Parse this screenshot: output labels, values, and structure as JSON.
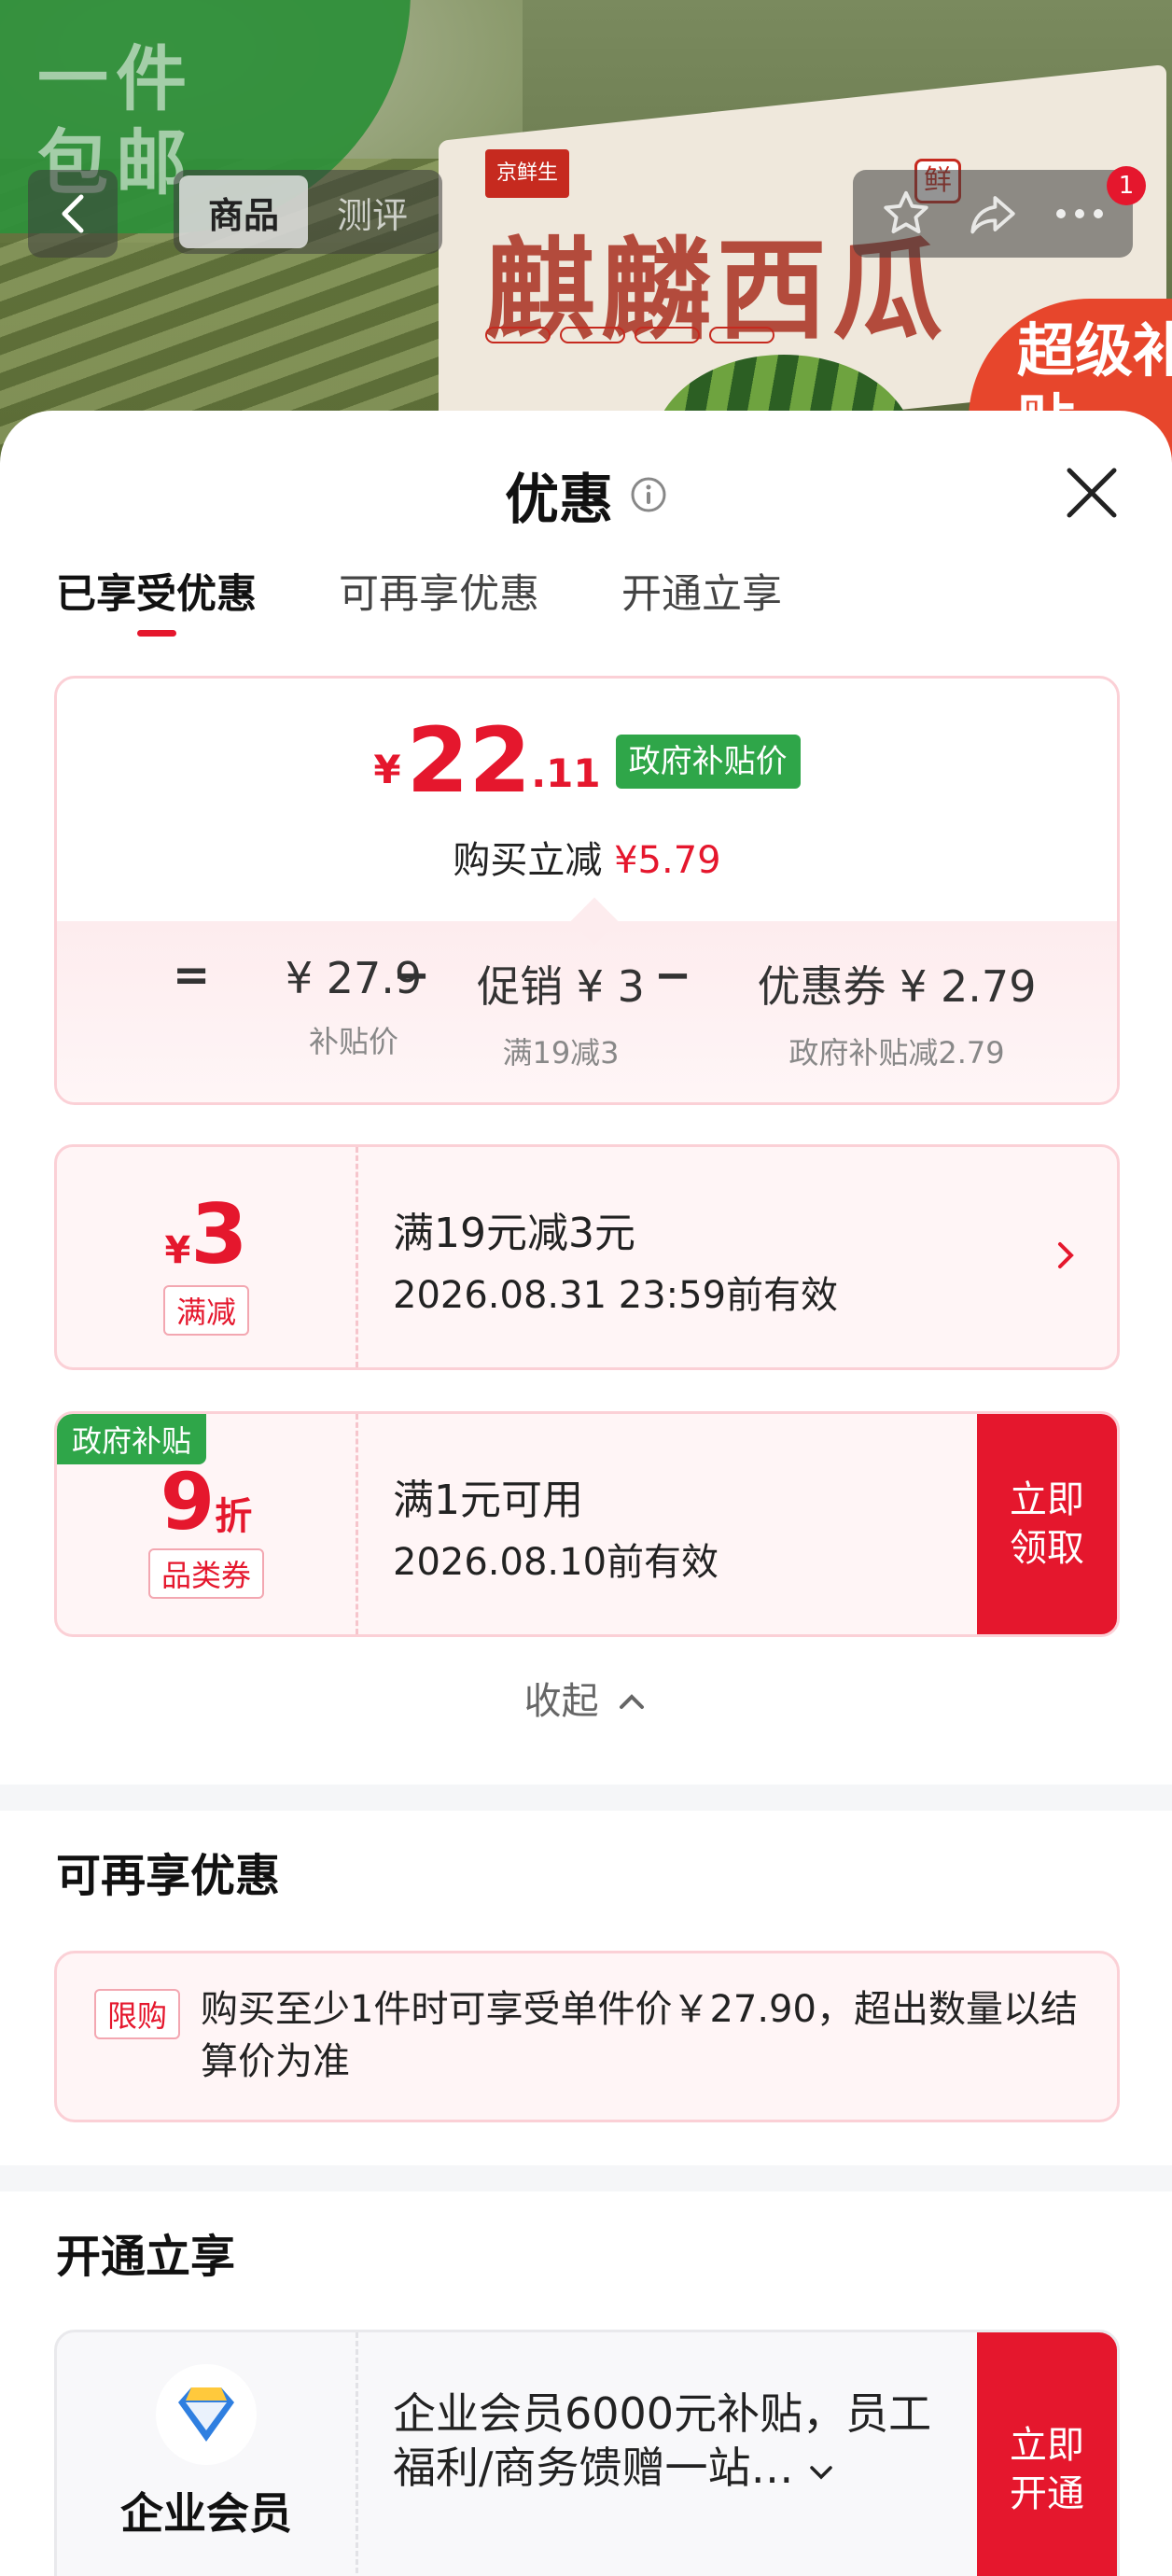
{
  "hero": {
    "promo_text": "一件包邮",
    "brand": "京鲜生",
    "product_title": "麒麟西瓜",
    "fresh_tag": "鲜",
    "badge_text": "超级补贴"
  },
  "nav": {
    "tabs": [
      {
        "label": "商品",
        "active": true
      },
      {
        "label": "测评",
        "active": false
      }
    ],
    "message_count": "1"
  },
  "sheet": {
    "title": "优惠",
    "tabs": [
      {
        "label": "已享受优惠",
        "active": true
      },
      {
        "label": "可再享优惠",
        "active": false
      },
      {
        "label": "开通立享",
        "active": false
      }
    ],
    "price": {
      "currency": "¥",
      "integer": "22",
      "decimal": ".11",
      "tag": "政府补贴价",
      "save_prefix": "购买立减",
      "save_amount": "¥5.79"
    },
    "calc": {
      "eq": "=",
      "minus": "−",
      "items": [
        {
          "value": "¥ 27.9",
          "label": "补贴价"
        },
        {
          "value": "促销 ¥ 3",
          "label": "满19减3"
        },
        {
          "value": "优惠券 ¥ 2.79",
          "label": "政府补贴减2.79"
        }
      ]
    },
    "coupons": [
      {
        "currency": "¥",
        "amount": "3",
        "type": "满减",
        "title": "满19元减3元",
        "validity": "2026.08.31 23:59前有效"
      },
      {
        "corner_tag": "政府补贴",
        "amount": "9",
        "unit": "折",
        "type": "品类券",
        "title": "满1元可用",
        "validity": "2026.08.10前有效",
        "action": "立即领取"
      }
    ],
    "collapse_label": "收起",
    "more_section": {
      "title": "可再享优惠",
      "tag": "限购",
      "text": "购买至少1件时可享受单件价￥27.90，超出数量以结算价为准"
    },
    "open_section": {
      "title": "开通立享",
      "member_name": "企业会员",
      "text": "企业会员6000元补贴，员工福利/商务馈赠一站…",
      "action": "立即开通"
    }
  },
  "colors": {
    "accent_red": "#e5172d",
    "gov_green": "#2fa649",
    "coupon_bg": "#fff5f6"
  }
}
